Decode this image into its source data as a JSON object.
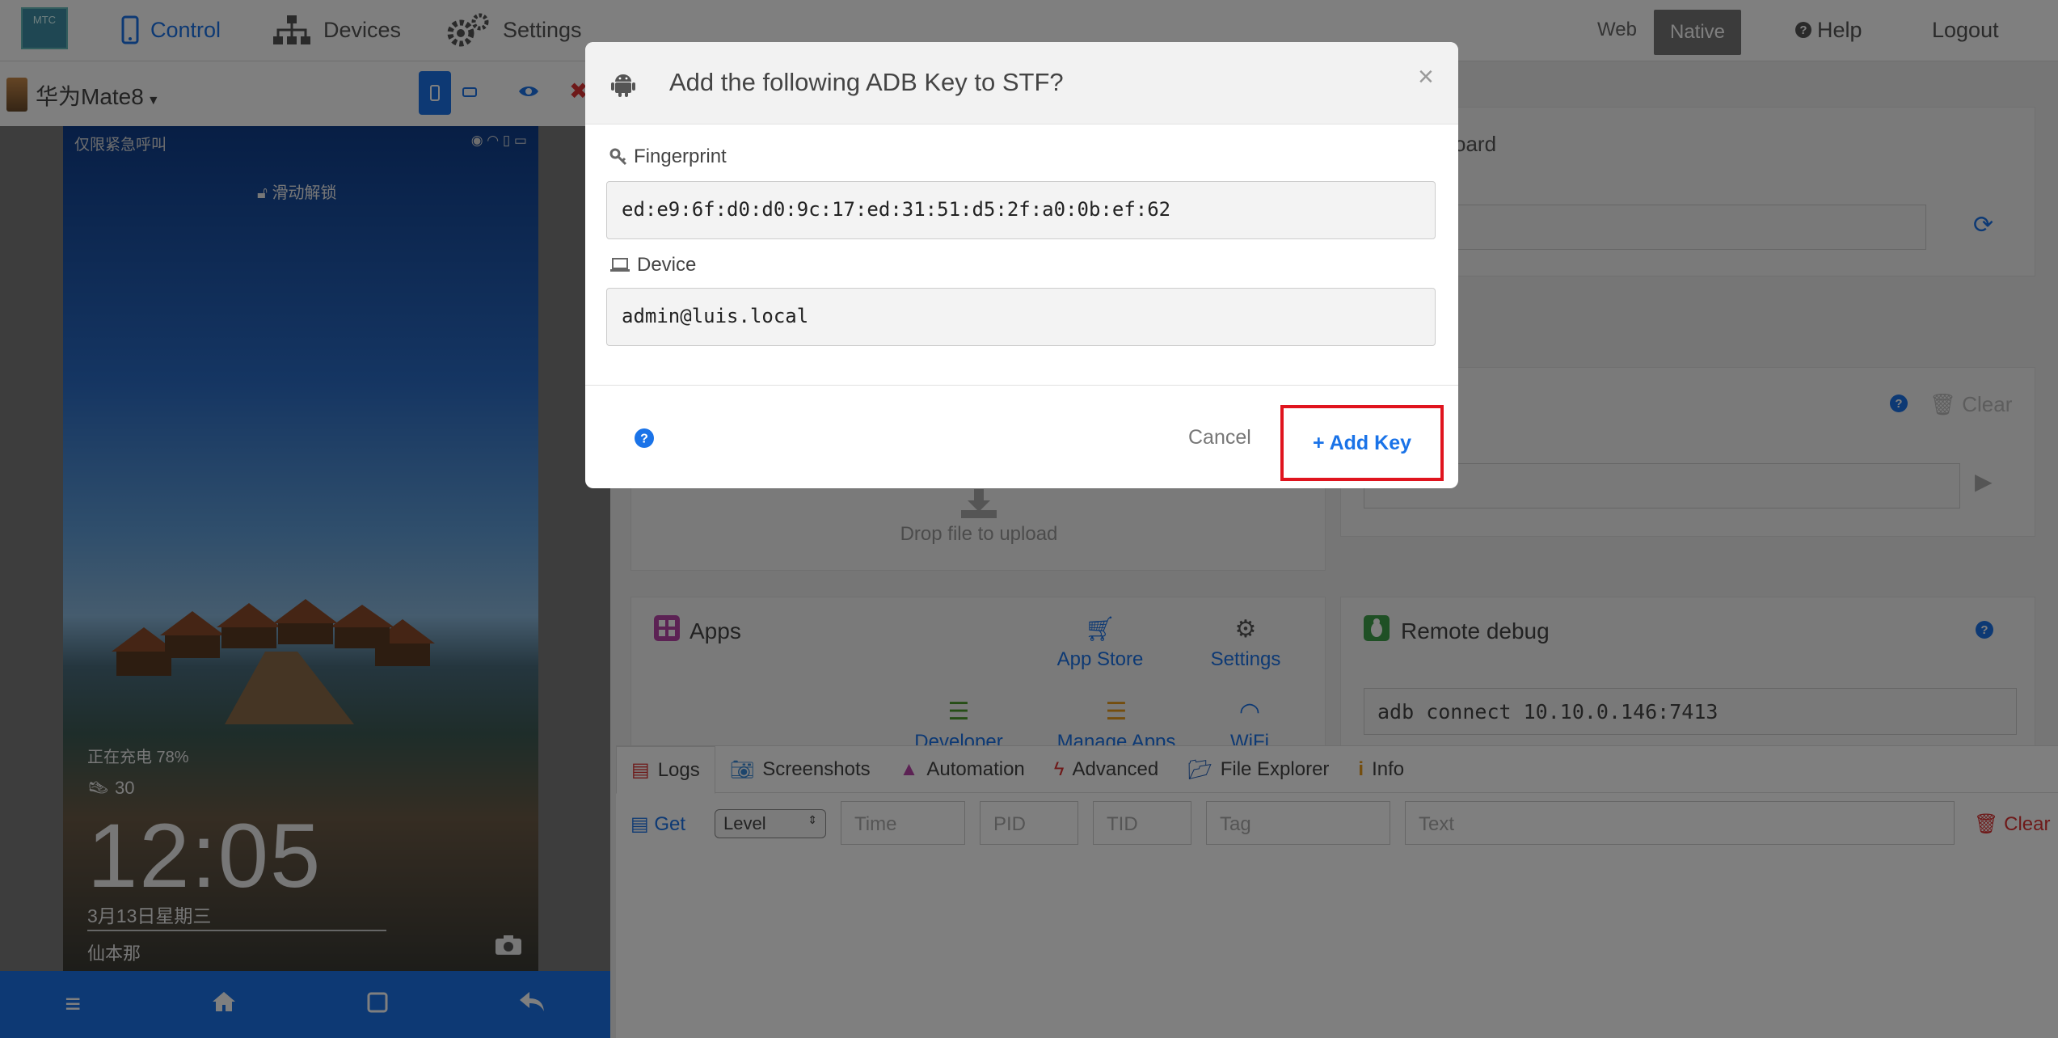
{
  "nav": {
    "logo_text": "MTC",
    "control": "Control",
    "devices": "Devices",
    "settings": "Settings",
    "web": "Web",
    "native": "Native",
    "help": "Help",
    "logout": "Logout"
  },
  "device": {
    "name": "华为Mate8",
    "status_left": "仅限紧急呼叫",
    "unlock_hint": "滑动解锁",
    "charging": "正在充电 78%",
    "steps": "30",
    "clock": "12:05",
    "date": "3月13日星期三",
    "location": "仙本那"
  },
  "clipboard": {
    "title": "oard"
  },
  "shell": {
    "clear": "Clear"
  },
  "upload": {
    "text": "Drop file to upload"
  },
  "apps": {
    "title": "Apps",
    "app_store": "App Store",
    "settings": "Settings",
    "developer": "Developer",
    "manage_apps": "Manage Apps",
    "wifi": "WiFi"
  },
  "remote": {
    "title": "Remote debug",
    "command": "adb connect 10.10.0.146:7413"
  },
  "tabs": [
    "Logs",
    "Screenshots",
    "Automation",
    "Advanced",
    "File Explorer",
    "Info"
  ],
  "logbar": {
    "get": "Get",
    "level": "Level",
    "time": "Time",
    "pid": "PID",
    "tid": "TID",
    "tag": "Tag",
    "text": "Text",
    "clear": "Clear"
  },
  "modal": {
    "title": "Add the following ADB Key to STF?",
    "close": "×",
    "fingerprint_label": "Fingerprint",
    "fingerprint_value": "ed:e9:6f:d0:d0:9c:17:ed:31:51:d5:2f:a0:0b:ef:62",
    "device_label": "Device",
    "device_value": "admin@luis.local",
    "cancel": "Cancel",
    "add_key": "Add Key"
  },
  "colors": {
    "accent": "#1a73e8",
    "danger": "#d33333",
    "highlight": "#e0141e"
  }
}
